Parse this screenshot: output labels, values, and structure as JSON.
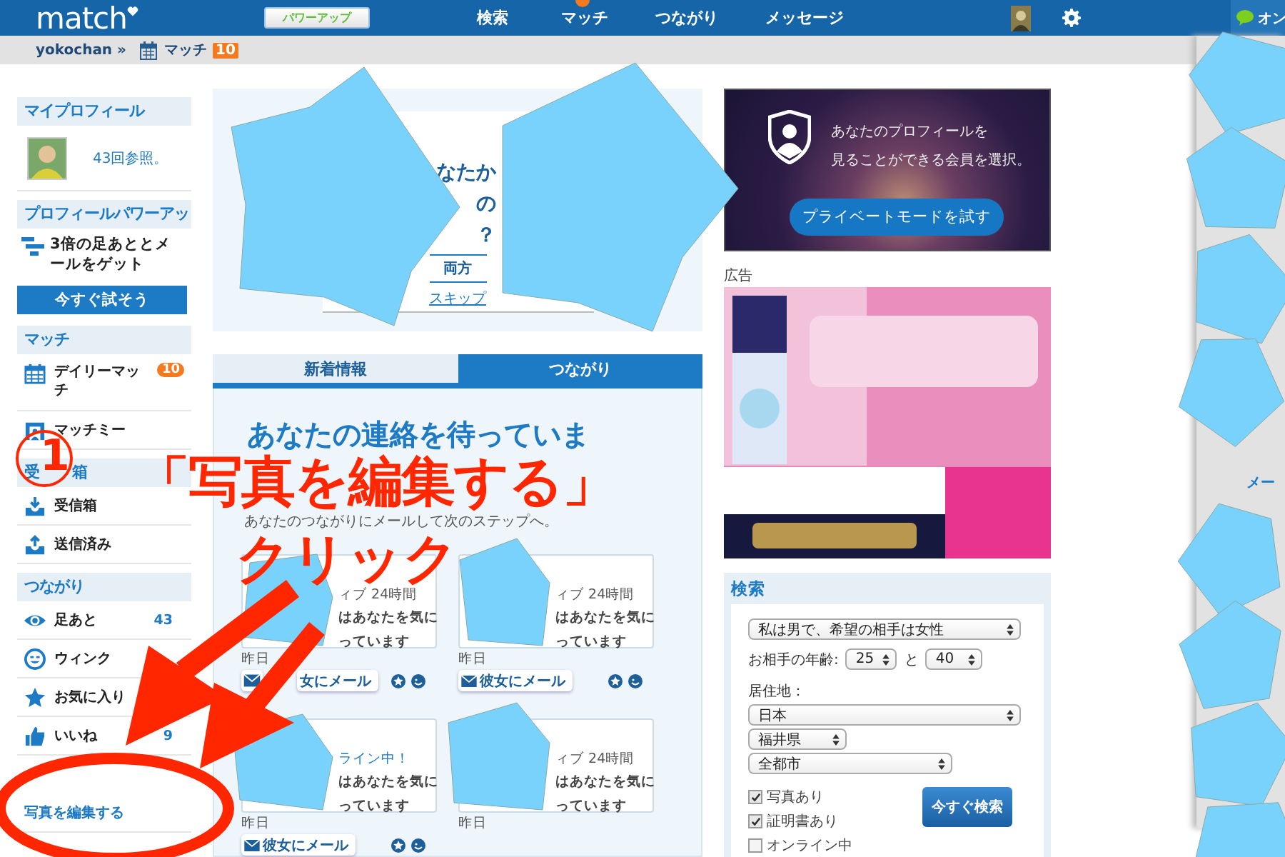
{
  "top_bar": {
    "logo": "match",
    "power_up_button": "パワーアップ",
    "nav": [
      {
        "label": "検索",
        "dot": false
      },
      {
        "label": "マッチ",
        "dot": true
      },
      {
        "label": "つながり",
        "dot": false
      },
      {
        "label": "メッセージ",
        "dot": false
      }
    ],
    "chat_label": "オン"
  },
  "sub_bar": {
    "username": "yokochan »",
    "match_label": "マッチ",
    "match_count": "10"
  },
  "sidebar": {
    "sections": [
      {
        "title_parts": [
          "マイプロフィール"
        ],
        "items": [
          {
            "kind": "profile",
            "text": "43回参照。"
          }
        ]
      },
      {
        "title_parts": [
          "プロフィールパワーアッ"
        ],
        "items": [
          {
            "kind": "promo",
            "text": "3倍の足あととメールをゲット",
            "button": "今すぐ試そう"
          }
        ]
      },
      {
        "title_parts": [
          "マッチ"
        ],
        "items": [
          {
            "kind": "link",
            "text": "デイリーマッチ",
            "badge": "10"
          },
          {
            "kind": "link",
            "text": "マッチミー"
          }
        ]
      },
      {
        "title_parts": [
          "受",
          "箱"
        ],
        "items": [
          {
            "kind": "link",
            "text": "受信箱"
          },
          {
            "kind": "link",
            "text": "送信済み"
          }
        ]
      },
      {
        "title_parts": [
          "つながり"
        ],
        "items": [
          {
            "kind": "link",
            "text": "足あと",
            "count": "43"
          },
          {
            "kind": "link",
            "text": "ウィンク"
          },
          {
            "kind": "link",
            "text": "お気に入り"
          },
          {
            "kind": "link",
            "text": "いいね",
            "count": "9"
          },
          {
            "kind": "text_link",
            "text": "写真を編集する"
          }
        ]
      }
    ]
  },
  "center": {
    "question_card": {
      "lines": [
        "なたか",
        "の",
        "？"
      ],
      "answer_button": "両方",
      "skip_link": "スキップ"
    },
    "tabs": [
      {
        "label": "新着情報",
        "selected": false
      },
      {
        "label": "つながり",
        "selected": true
      }
    ],
    "heading": "あなたの連絡を待っていま",
    "subtext": "あなたのつながりにメールして次のステップへ。",
    "cards": [
      {
        "kind": "active",
        "status": "ィブ 24時間",
        "message_lines": [
          "はあなたを気に",
          "っています"
        ],
        "date": "昨日",
        "mail_button": "女にメール"
      },
      {
        "kind": "active",
        "status": "ィブ 24時間",
        "message_lines": [
          "はあなたを気に",
          "っています"
        ],
        "date": "昨日",
        "mail_button": "彼女にメール"
      },
      {
        "kind": "online",
        "status": "ライン中！",
        "message_lines": [
          "はあなたを気に",
          "っています"
        ],
        "date": "昨日",
        "mail_button": "彼女にメール"
      },
      {
        "kind": "active",
        "status": "ィブ 24時間",
        "message_lines": [
          "はあなたを気に",
          "っています"
        ],
        "date": "昨日"
      }
    ]
  },
  "right": {
    "private_ad": {
      "text_lines": [
        "あなたのプロフィールを",
        "見ることができる会員を選択。"
      ],
      "button": "プライベートモードを試す"
    },
    "ad_label": "広告",
    "search": {
      "title": "検索",
      "gender_select": "私は男で、希望の相手は女性",
      "age_label": "お相手の年齢:",
      "age_from": "25",
      "age_joiner": "と",
      "age_to": "40",
      "location_label": "居住地：",
      "country": "日本",
      "prefecture": "福井県",
      "city": "全都市",
      "filters": [
        {
          "label": "写真あり",
          "checked": true
        },
        {
          "label": "証明書あり",
          "checked": true
        },
        {
          "label": "オンライン中",
          "checked": false
        }
      ],
      "search_button": "今すぐ検索"
    }
  },
  "right_rail": {
    "mail_label": "メー"
  },
  "annotations": {
    "step_number": "1",
    "instruction": "「写真を編集する」",
    "action": "クリック"
  }
}
